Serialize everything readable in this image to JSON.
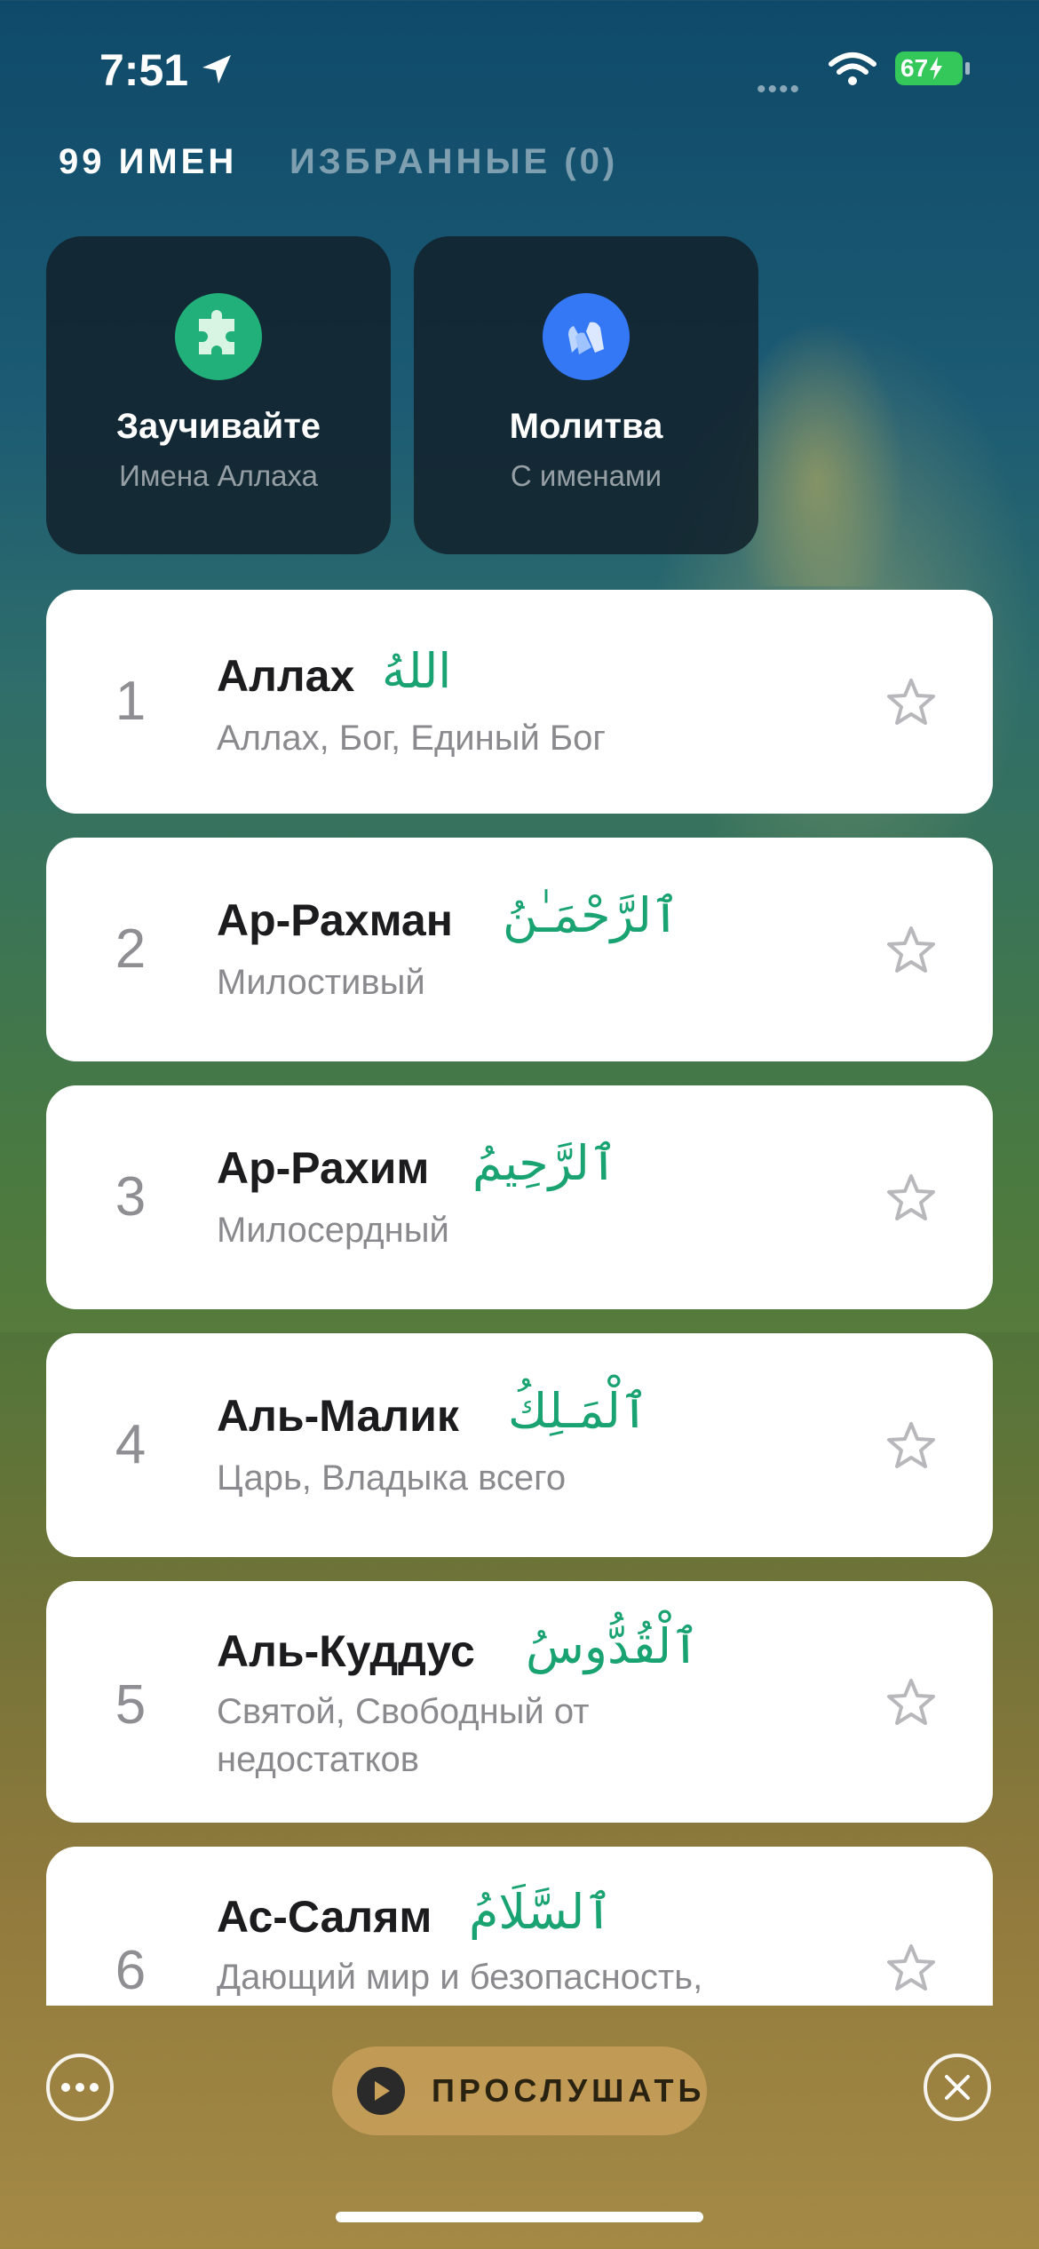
{
  "status_bar": {
    "time": "7:51",
    "battery": "67"
  },
  "tabs": [
    {
      "label": "99 ИМЕН",
      "active": true
    },
    {
      "label": "ИЗБРАННЫЕ (0)",
      "active": false
    }
  ],
  "tiles": [
    {
      "title": "Заучивайте",
      "subtitle": "Имена Аллаха",
      "icon": "puzzle-icon",
      "color": "#21b07a"
    },
    {
      "title": "Молитва",
      "subtitle": "С именами",
      "icon": "praying-hands-icon",
      "color": "#3478f6"
    }
  ],
  "names": [
    {
      "number": "1",
      "name": "Аллах",
      "arabic": "اللهُ",
      "meaning": "Аллах, Бог, Единый Бог"
    },
    {
      "number": "2",
      "name": "Ар-Рахман",
      "arabic": "ٱلرَّحْمَـٰنُ",
      "meaning": "Милостивый"
    },
    {
      "number": "3",
      "name": "Ар-Рахим",
      "arabic": "ٱلرَّحِيمُ",
      "meaning": "Милосердный"
    },
    {
      "number": "4",
      "name": "Аль-Малик",
      "arabic": "ٱلْمَـلِكُ",
      "meaning": "Царь, Владыка всего"
    },
    {
      "number": "5",
      "name": "Аль-Куддус",
      "arabic": "ٱلْقُدُّوسُ",
      "meaning": "Святой, Свободный от недостатков"
    },
    {
      "number": "6",
      "name": "Ас-Салям",
      "arabic": "ٱلسَّلَامُ",
      "meaning": "Дающий мир и безопасность,"
    }
  ],
  "bottom_bar": {
    "listen_label": "ПРОСЛУШАТЬ"
  },
  "colors": {
    "accent_green": "#1aa372",
    "button_gold": "#c8a05a"
  }
}
